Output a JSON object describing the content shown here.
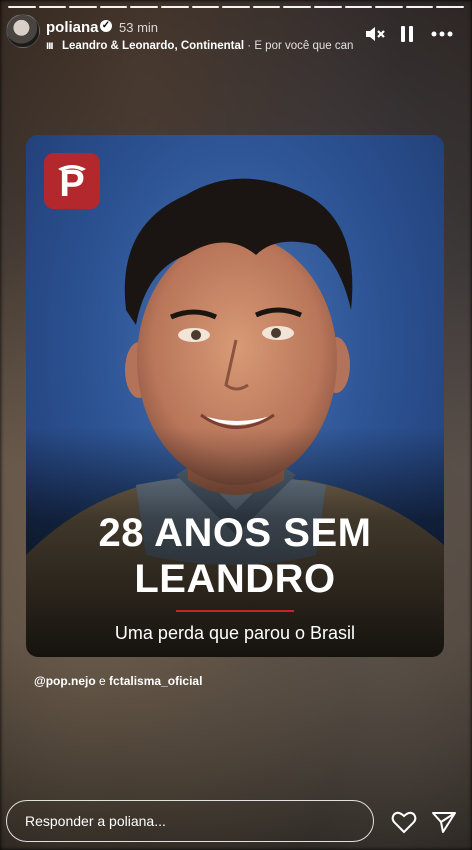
{
  "story": {
    "progress_segments": 15
  },
  "header": {
    "username": "poliana",
    "verified_mark": "✓",
    "time_ago": "53 min",
    "music_bars": "ııı",
    "music_title": "Leandro & Leonardo, Continental",
    "music_extra": " · É por você que can"
  },
  "post": {
    "headline_line1": "28 ANOS SEM",
    "headline_line2": "LEANDRO",
    "subtitle": "Uma perda que parou o Brasil",
    "accent_color": "#c7232a",
    "logo_color": "#b3282d"
  },
  "mentions": {
    "first": "@pop.nejo",
    "separator": " e ",
    "second": "fctalisma_oficial"
  },
  "reply": {
    "placeholder": "Responder a poliana..."
  },
  "icons": {
    "mute": "speaker-muted-icon",
    "pause": "pause-icon",
    "more": "more-horizontal-icon",
    "like": "heart-icon",
    "share": "paper-plane-icon"
  }
}
